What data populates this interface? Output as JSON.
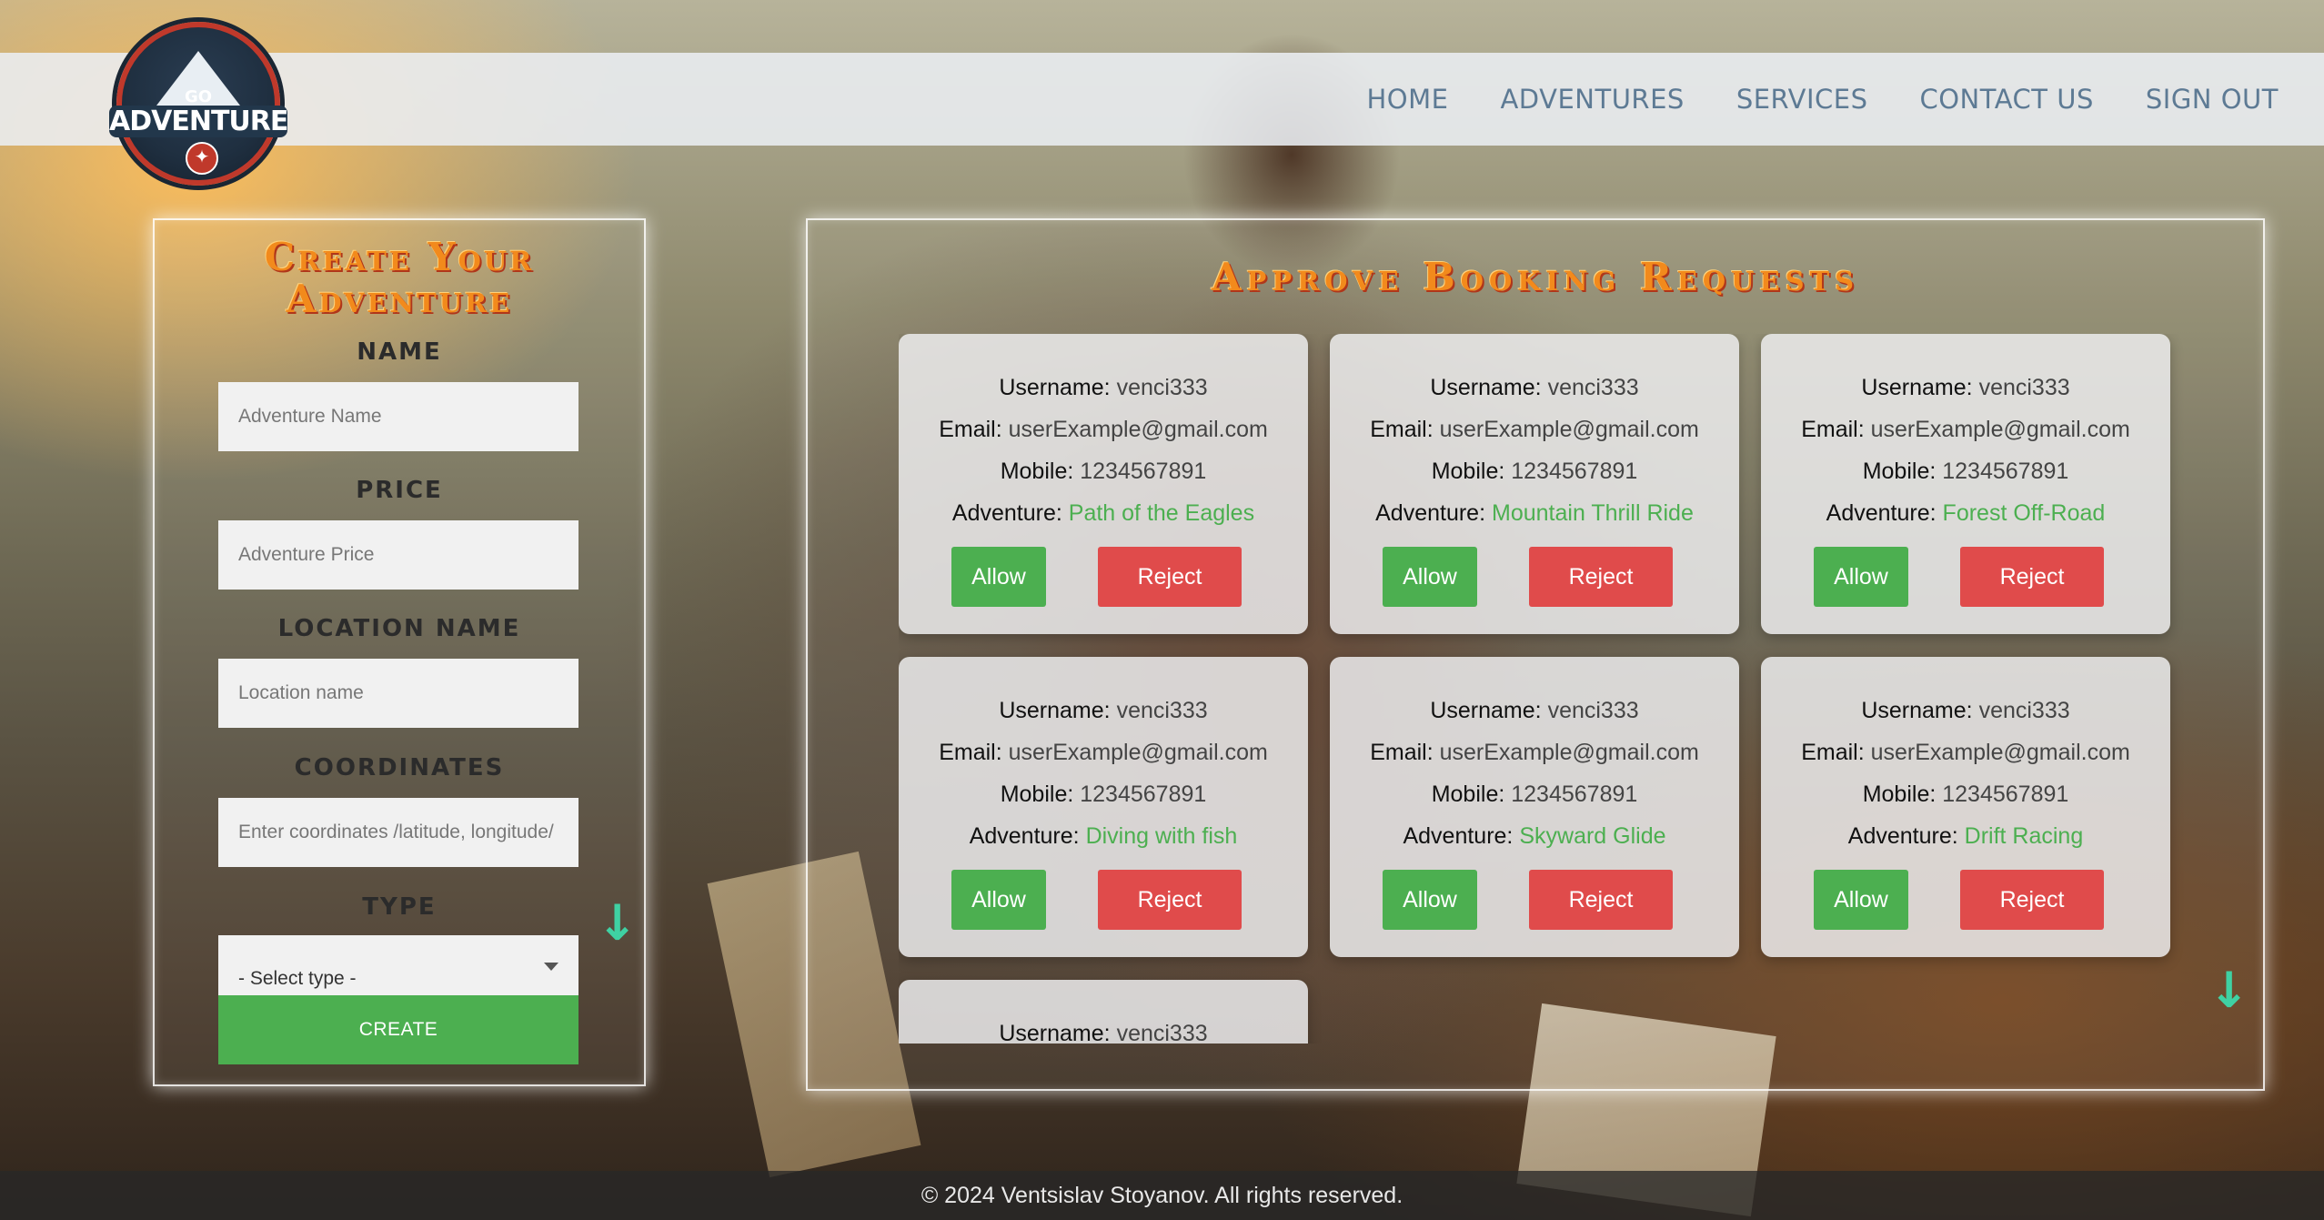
{
  "brand": {
    "logo_small_text": "GO",
    "logo_text": "ADVENTURE"
  },
  "nav": {
    "items": [
      "HOME",
      "ADVENTURES",
      "SERVICES",
      "CONTACT US",
      "SIGN OUT"
    ]
  },
  "create_form": {
    "title": "Create Your Adventure",
    "name_label": "NAME",
    "name_placeholder": "Adventure Name",
    "price_label": "PRICE",
    "price_placeholder": "Adventure Price",
    "location_label": "LOCATION NAME",
    "location_placeholder": "Location name",
    "coordinates_label": "COORDINATES",
    "coordinates_placeholder": "Enter coordinates /latitude, longitude/",
    "type_label": "TYPE",
    "type_selected": "- Select type -",
    "create_button": "CREATE"
  },
  "requests": {
    "title": "Approve Booking Requests",
    "labels": {
      "username": "Username:",
      "email": "Email:",
      "mobile": "Mobile:",
      "adventure": "Adventure:"
    },
    "allow_label": "Allow",
    "reject_label": "Reject",
    "items": [
      {
        "username": "venci333",
        "email": "userExample@gmail.com",
        "mobile": "1234567891",
        "adventure": "Path of the Eagles"
      },
      {
        "username": "venci333",
        "email": "userExample@gmail.com",
        "mobile": "1234567891",
        "adventure": "Mountain Thrill Ride"
      },
      {
        "username": "venci333",
        "email": "userExample@gmail.com",
        "mobile": "1234567891",
        "adventure": "Forest Off-Road"
      },
      {
        "username": "venci333",
        "email": "userExample@gmail.com",
        "mobile": "1234567891",
        "adventure": "Diving with fish"
      },
      {
        "username": "venci333",
        "email": "userExample@gmail.com",
        "mobile": "1234567891",
        "adventure": "Skyward Glide"
      },
      {
        "username": "venci333",
        "email": "userExample@gmail.com",
        "mobile": "1234567891",
        "adventure": "Drift Racing"
      },
      {
        "username": "venci333"
      }
    ]
  },
  "scroll_arrow": "↓",
  "footer": {
    "text": "© 2024 Ventsislav Stoyanov. All rights reserved."
  },
  "colors": {
    "accent_green": "#4caf50",
    "reject_red": "#e04b4b",
    "title_orange": "#f28a1c",
    "nav_text": "#5d7a94",
    "scroll_arrow": "#3fd1a3"
  }
}
